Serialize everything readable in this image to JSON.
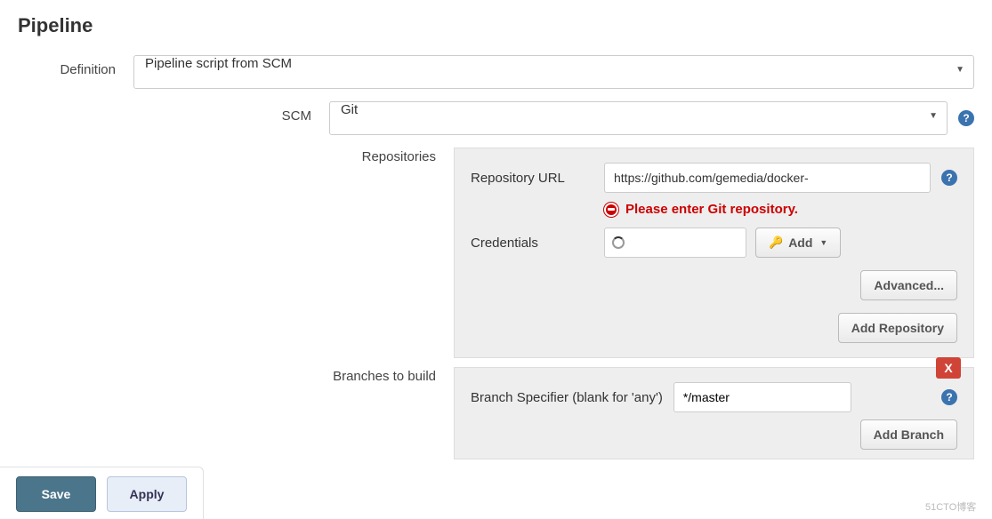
{
  "section": {
    "title": "Pipeline"
  },
  "definition": {
    "label": "Definition",
    "value": "Pipeline script from SCM"
  },
  "scm": {
    "label": "SCM",
    "value": "Git"
  },
  "repositories": {
    "label": "Repositories",
    "url_label": "Repository URL",
    "url_value": "https://github.com/gemedia/docker-",
    "error_text": "Please enter Git repository.",
    "credentials_label": "Credentials",
    "add_label": "Add",
    "advanced_label": "Advanced...",
    "add_repo_label": "Add Repository"
  },
  "branches": {
    "label": "Branches to build",
    "specifier_label": "Branch Specifier (blank for 'any')",
    "specifier_value": "*/master",
    "close_label": "X",
    "add_branch_label": "Add Branch"
  },
  "actions": {
    "save": "Save",
    "apply": "Apply"
  },
  "watermark": "51CTO博客"
}
